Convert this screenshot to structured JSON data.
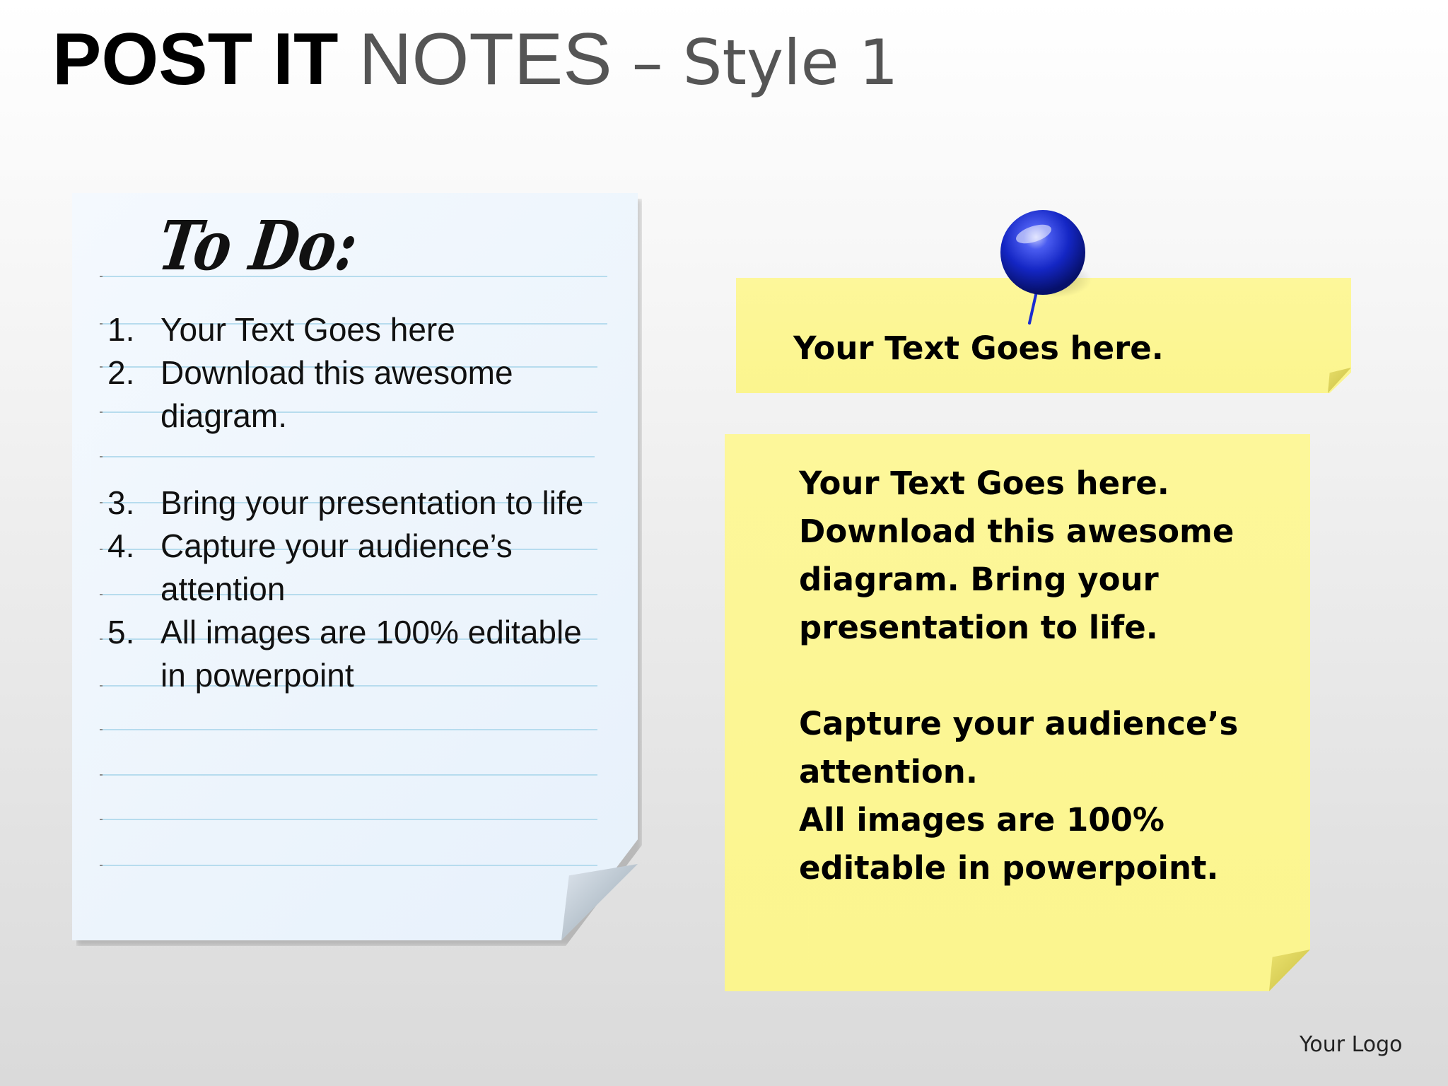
{
  "title": {
    "bold": "POST  IT",
    "light": " NOTES",
    "style": " – Style 1"
  },
  "todo_note": {
    "heading": "To Do:",
    "items": [
      {
        "number": "1.",
        "text": "Your Text Goes here"
      },
      {
        "number": "2.",
        "text": "Download this awesome diagram."
      },
      {
        "number": "3.",
        "text": "Bring your presentation to life"
      },
      {
        "number": "4.",
        "text": "Capture your audience’s attention"
      },
      {
        "number": "5.",
        "text": "All images are 100% editable in powerpoint"
      }
    ]
  },
  "small_sticky": {
    "text": "Your Text Goes here.",
    "color": "#fbf58e"
  },
  "large_sticky": {
    "paragraph_1": "Your Text Goes here. Download this awesome diagram. Bring your presentation to life.",
    "paragraph_2_line_1": "Capture your audience’s attention.",
    "paragraph_2_line_2": "All images are 100% editable in powerpoint.",
    "color": "#fbf58e"
  },
  "pin": {
    "icon": "push-pin-icon",
    "color": "#1a2bd1"
  },
  "logo": {
    "text": "Your Logo"
  }
}
